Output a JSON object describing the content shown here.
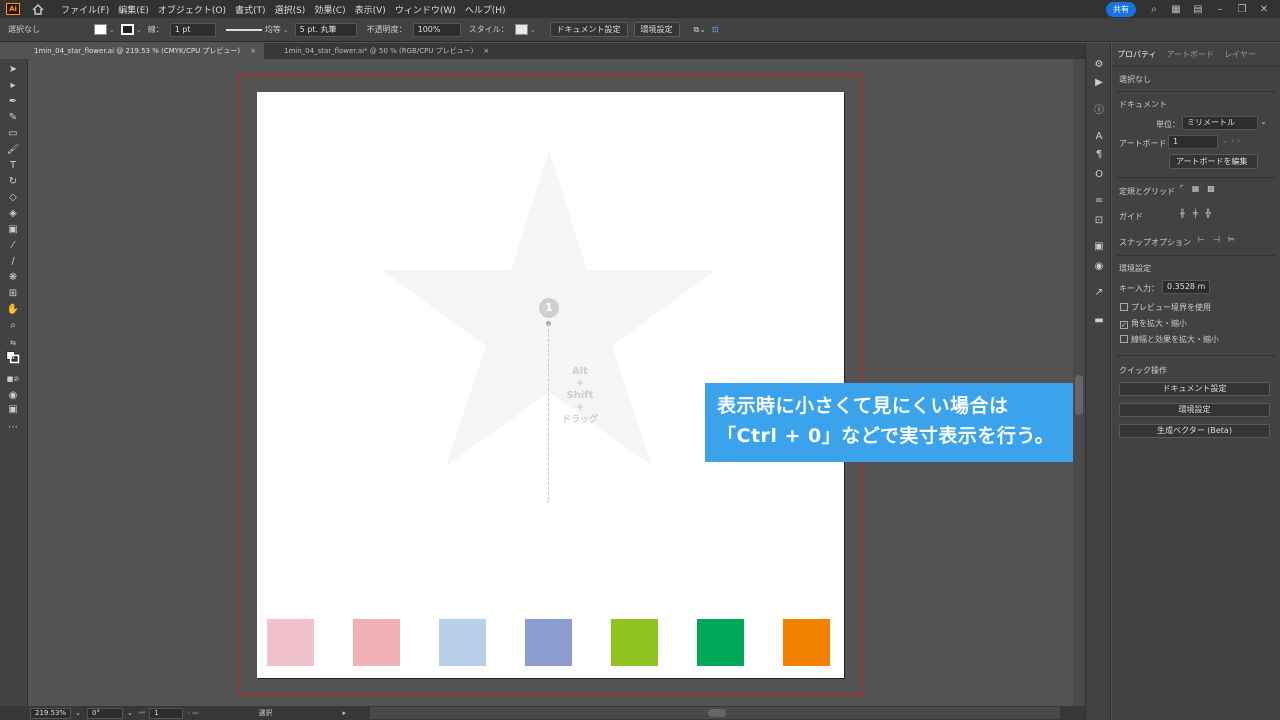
{
  "menubar": {
    "app_logo": "Ai",
    "items": [
      "ファイル(F)",
      "編集(E)",
      "オブジェクト(O)",
      "書式(T)",
      "選択(S)",
      "効果(C)",
      "表示(V)",
      "ウィンドウ(W)",
      "ヘルプ(H)"
    ],
    "share_label": "共有"
  },
  "control_bar": {
    "selection": "選択なし",
    "stroke_label": "線：",
    "stroke_weight": "1 pt",
    "line_style": "均等",
    "brush": "5 pt. 丸筆",
    "opacity_label": "不透明度：",
    "opacity_value": "100%",
    "style_label": "スタイル：",
    "doc_setup_button": "ドキュメント設定",
    "preferences_button": "環境設定"
  },
  "tabs": [
    {
      "label": "1min_04_star_flower.ai @ 219.53 % (CMYK/CPU プレビュー)",
      "active": true,
      "close": "×"
    },
    {
      "label": "1min_04_star_flower.ai* @ 50 % (RGB/CPU プレビュー)",
      "active": false,
      "close": "×"
    }
  ],
  "canvas": {
    "guide_number": "1",
    "hint_lines": [
      "Alt",
      "+",
      "Shift",
      "+",
      "ドラッグ"
    ],
    "swatch_colors": [
      "#f2c2cc",
      "#f0b1b4",
      "#b9cfea",
      "#8d9dcf",
      "#8fc31f",
      "#00a85a",
      "#f08200"
    ],
    "star_color": "#f5f5f5"
  },
  "callout": {
    "line1": "表示時に小さくて見にくい場合は",
    "line2": "「Ctrl + 0」などで実寸表示を行う。",
    "color": "#3aa3eb"
  },
  "properties_panel": {
    "tabs": [
      "プロパティ",
      "アートボード",
      "レイヤー"
    ],
    "no_selection": "選択なし",
    "document_heading": "ドキュメント",
    "units_label": "単位：",
    "units_value": "ミリメートル",
    "artboard_label": "アートボード：",
    "artboard_value": "1",
    "edit_artboard_button": "アートボードを編集",
    "rulers_grids_label": "定規とグリッド",
    "guides_label": "ガイド",
    "snap_label": "スナップオプション",
    "preferences_heading": "環境設定",
    "keyboard_increment_label": "キー入力：",
    "keyboard_increment_value": "0.3528 m",
    "checkbox_preview_bounds": "プレビュー境界を使用",
    "checkbox_scale_corners": "角を拡大・縮小",
    "checkbox_scale_strokes": "線幅と効果を拡大・縮小",
    "quick_actions_heading": "クイック操作",
    "qa_doc_setup": "ドキュメント設定",
    "qa_preferences": "環境設定",
    "qa_generate_vector": "生成ベクター (Beta)"
  },
  "statusbar": {
    "zoom": "219.53%",
    "rotation": "0°",
    "artboard_nav": "1",
    "tool_status": "選択"
  }
}
